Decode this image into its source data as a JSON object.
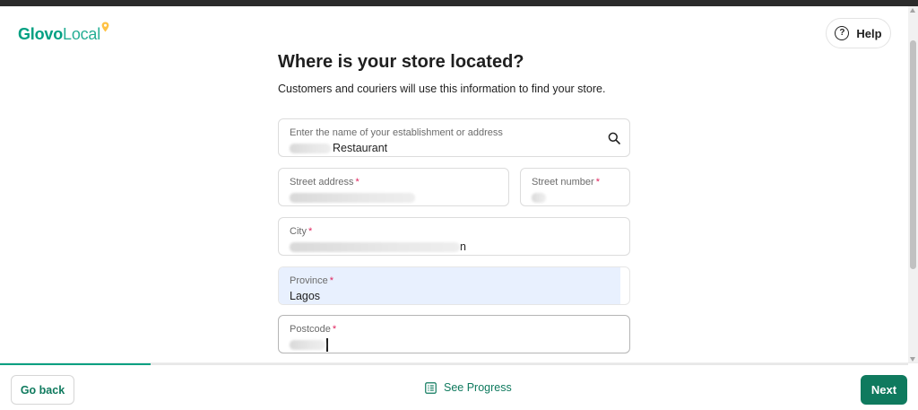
{
  "brand": {
    "name_part1": "Glovo",
    "name_part2": "Local",
    "color": "#00a082"
  },
  "header": {
    "help_label": "Help",
    "help_icon": "question-circle-icon"
  },
  "page": {
    "title": "Where is your store located?",
    "subtitle": "Customers and couriers will use this information to find your store."
  },
  "form": {
    "search": {
      "label": "Enter the name of your establishment or address",
      "value": "Restaurant",
      "icon": "search-icon"
    },
    "street_address": {
      "label": "Street address",
      "required_mark": "*"
    },
    "street_number": {
      "label": "Street number",
      "required_mark": "*"
    },
    "city": {
      "label": "City",
      "required_mark": "*",
      "value_suffix": "n"
    },
    "province": {
      "label": "Province",
      "required_mark": "*",
      "value": "Lagos"
    },
    "postcode": {
      "label": "Postcode",
      "required_mark": "*"
    }
  },
  "footer": {
    "progress_fraction": 0.166,
    "go_back_label": "Go back",
    "see_progress_label": "See Progress",
    "see_progress_icon": "list-icon",
    "next_label": "Next"
  },
  "colors": {
    "accent": "#0f7a5e",
    "autofill_bg": "#e8f0fe",
    "required": "#e0245e"
  }
}
